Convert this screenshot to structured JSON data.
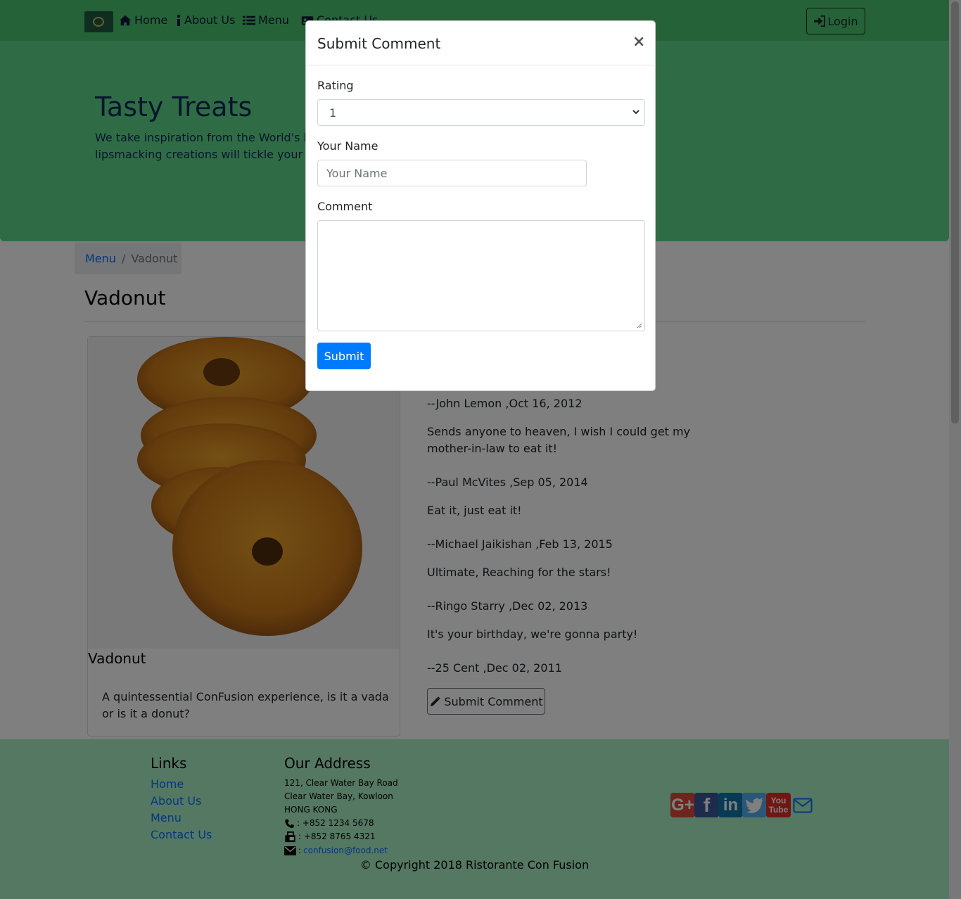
{
  "navbar": {
    "items": [
      {
        "label": "Home",
        "icon": "home-icon"
      },
      {
        "label": "About Us",
        "icon": "info-icon"
      },
      {
        "label": "Menu",
        "icon": "list-icon"
      },
      {
        "label": "Contact Us",
        "icon": "address-card-icon"
      }
    ],
    "login_label": "Login"
  },
  "jumbotron": {
    "title": "Tasty Treats",
    "text": "We take inspiration from the World's best cuisines, and create a unique fusion experience. Our lipsmacking creations will tickle your culinary senses!"
  },
  "breadcrumb": {
    "link": "Menu",
    "separator": "/",
    "active": "Vadonut"
  },
  "dish": {
    "heading": "Vadonut",
    "card_title": "Vadonut",
    "description": "A quintessential ConFusion experience, is it a vada or is it a donut?"
  },
  "comments": [
    {
      "author_line": "--John Lemon ,Oct 16, 2012"
    },
    {
      "text": "Sends anyone to heaven, I wish I could get my mother-in-law to eat it!",
      "author_line": "--Paul McVites ,Sep 05, 2014"
    },
    {
      "text": "Eat it, just eat it!",
      "author_line": "--Michael Jaikishan ,Feb 13, 2015"
    },
    {
      "text": "Ultimate, Reaching for the stars!",
      "author_line": "--Ringo Starry ,Dec 02, 2013"
    },
    {
      "text": "It's your birthday, we're gonna party!",
      "author_line": "--25 Cent ,Dec 02, 2011"
    }
  ],
  "submit_comment_button": "Submit Comment",
  "footer": {
    "links_heading": "Links",
    "links": [
      "Home",
      "About Us",
      "Menu",
      "Contact Us"
    ],
    "address_heading": "Our Address",
    "address_lines": [
      "121, Clear Water Bay Road",
      "Clear Water Bay, Kowloon",
      "HONG KONG"
    ],
    "phone": ": +852 1234 5678",
    "fax": ": +852 8765 4321",
    "email_sep": ":",
    "email": "confusion@food.net",
    "social_icons": [
      "google-plus-icon",
      "facebook-icon",
      "linkedin-icon",
      "twitter-icon",
      "youtube-icon",
      "mail-icon"
    ],
    "copyright": "© Copyright 2018 Ristorante Con Fusion"
  },
  "modal": {
    "title": "Submit Comment",
    "close": "×",
    "rating_label": "Rating",
    "rating_value": "1",
    "name_label": "Your Name",
    "name_placeholder": "Your Name",
    "comment_label": "Comment",
    "submit_label": "Submit"
  },
  "colors": {
    "navbar": "#4dc46f",
    "jumbotron": "#5ed98a",
    "footer": "#a8f0c4",
    "primary": "#007bff"
  }
}
